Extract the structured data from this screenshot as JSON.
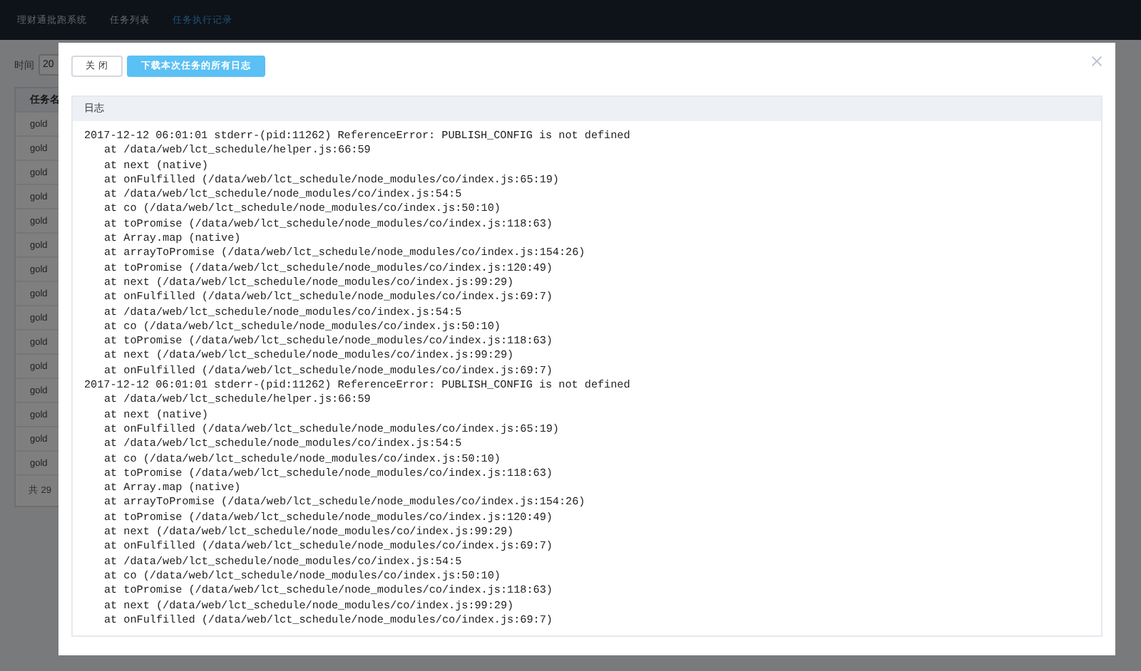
{
  "nav": {
    "title": "理财通批跑系统",
    "items": [
      {
        "label": "任务列表",
        "selected": false
      },
      {
        "label": "任务执行记录",
        "selected": true
      }
    ]
  },
  "filter": {
    "label": "时间",
    "value": "20"
  },
  "table": {
    "columns": [
      "任务名"
    ],
    "rows": [
      [
        "gold"
      ],
      [
        "gold"
      ],
      [
        "gold"
      ],
      [
        "gold"
      ],
      [
        "gold"
      ],
      [
        "gold"
      ],
      [
        "gold"
      ],
      [
        "gold"
      ],
      [
        "gold"
      ],
      [
        "gold"
      ],
      [
        "gold"
      ],
      [
        "gold"
      ],
      [
        "gold"
      ],
      [
        "gold"
      ],
      [
        "gold"
      ]
    ],
    "footer": "共 29"
  },
  "modal": {
    "buttons": [
      {
        "label": "关 闭",
        "kind": "default"
      },
      {
        "label": "下载本次任务的所有日志",
        "kind": "primary"
      }
    ],
    "log": {
      "title": "日志",
      "entries": [
        {
          "text": "2017-12-12 06:01:01 stderr-(pid:11262) ReferenceError: PUBLISH_CONFIG is not defined",
          "frames": [
            "at /data/web/lct_schedule/helper.js:66:59",
            "at next (native)",
            "at onFulfilled (/data/web/lct_schedule/node_modules/co/index.js:65:19)",
            "at /data/web/lct_schedule/node_modules/co/index.js:54:5",
            "at co (/data/web/lct_schedule/node_modules/co/index.js:50:10)",
            "at toPromise (/data/web/lct_schedule/node_modules/co/index.js:118:63)",
            "at Array.map (native)",
            "at arrayToPromise (/data/web/lct_schedule/node_modules/co/index.js:154:26)",
            "at toPromise (/data/web/lct_schedule/node_modules/co/index.js:120:49)",
            "at next (/data/web/lct_schedule/node_modules/co/index.js:99:29)",
            "at onFulfilled (/data/web/lct_schedule/node_modules/co/index.js:69:7)",
            "at /data/web/lct_schedule/node_modules/co/index.js:54:5",
            "at co (/data/web/lct_schedule/node_modules/co/index.js:50:10)",
            "at toPromise (/data/web/lct_schedule/node_modules/co/index.js:118:63)",
            "at next (/data/web/lct_schedule/node_modules/co/index.js:99:29)",
            "at onFulfilled (/data/web/lct_schedule/node_modules/co/index.js:69:7)"
          ]
        },
        {
          "text": "2017-12-12 06:01:01 stderr-(pid:11262) ReferenceError: PUBLISH_CONFIG is not defined",
          "frames": [
            "at /data/web/lct_schedule/helper.js:66:59",
            "at next (native)",
            "at onFulfilled (/data/web/lct_schedule/node_modules/co/index.js:65:19)",
            "at /data/web/lct_schedule/node_modules/co/index.js:54:5",
            "at co (/data/web/lct_schedule/node_modules/co/index.js:50:10)",
            "at toPromise (/data/web/lct_schedule/node_modules/co/index.js:118:63)",
            "at Array.map (native)",
            "at arrayToPromise (/data/web/lct_schedule/node_modules/co/index.js:154:26)",
            "at toPromise (/data/web/lct_schedule/node_modules/co/index.js:120:49)",
            "at next (/data/web/lct_schedule/node_modules/co/index.js:99:29)",
            "at onFulfilled (/data/web/lct_schedule/node_modules/co/index.js:69:7)",
            "at /data/web/lct_schedule/node_modules/co/index.js:54:5",
            "at co (/data/web/lct_schedule/node_modules/co/index.js:50:10)",
            "at toPromise (/data/web/lct_schedule/node_modules/co/index.js:118:63)",
            "at next (/data/web/lct_schedule/node_modules/co/index.js:99:29)",
            "at onFulfilled (/data/web/lct_schedule/node_modules/co/index.js:69:7)"
          ]
        }
      ]
    }
  }
}
